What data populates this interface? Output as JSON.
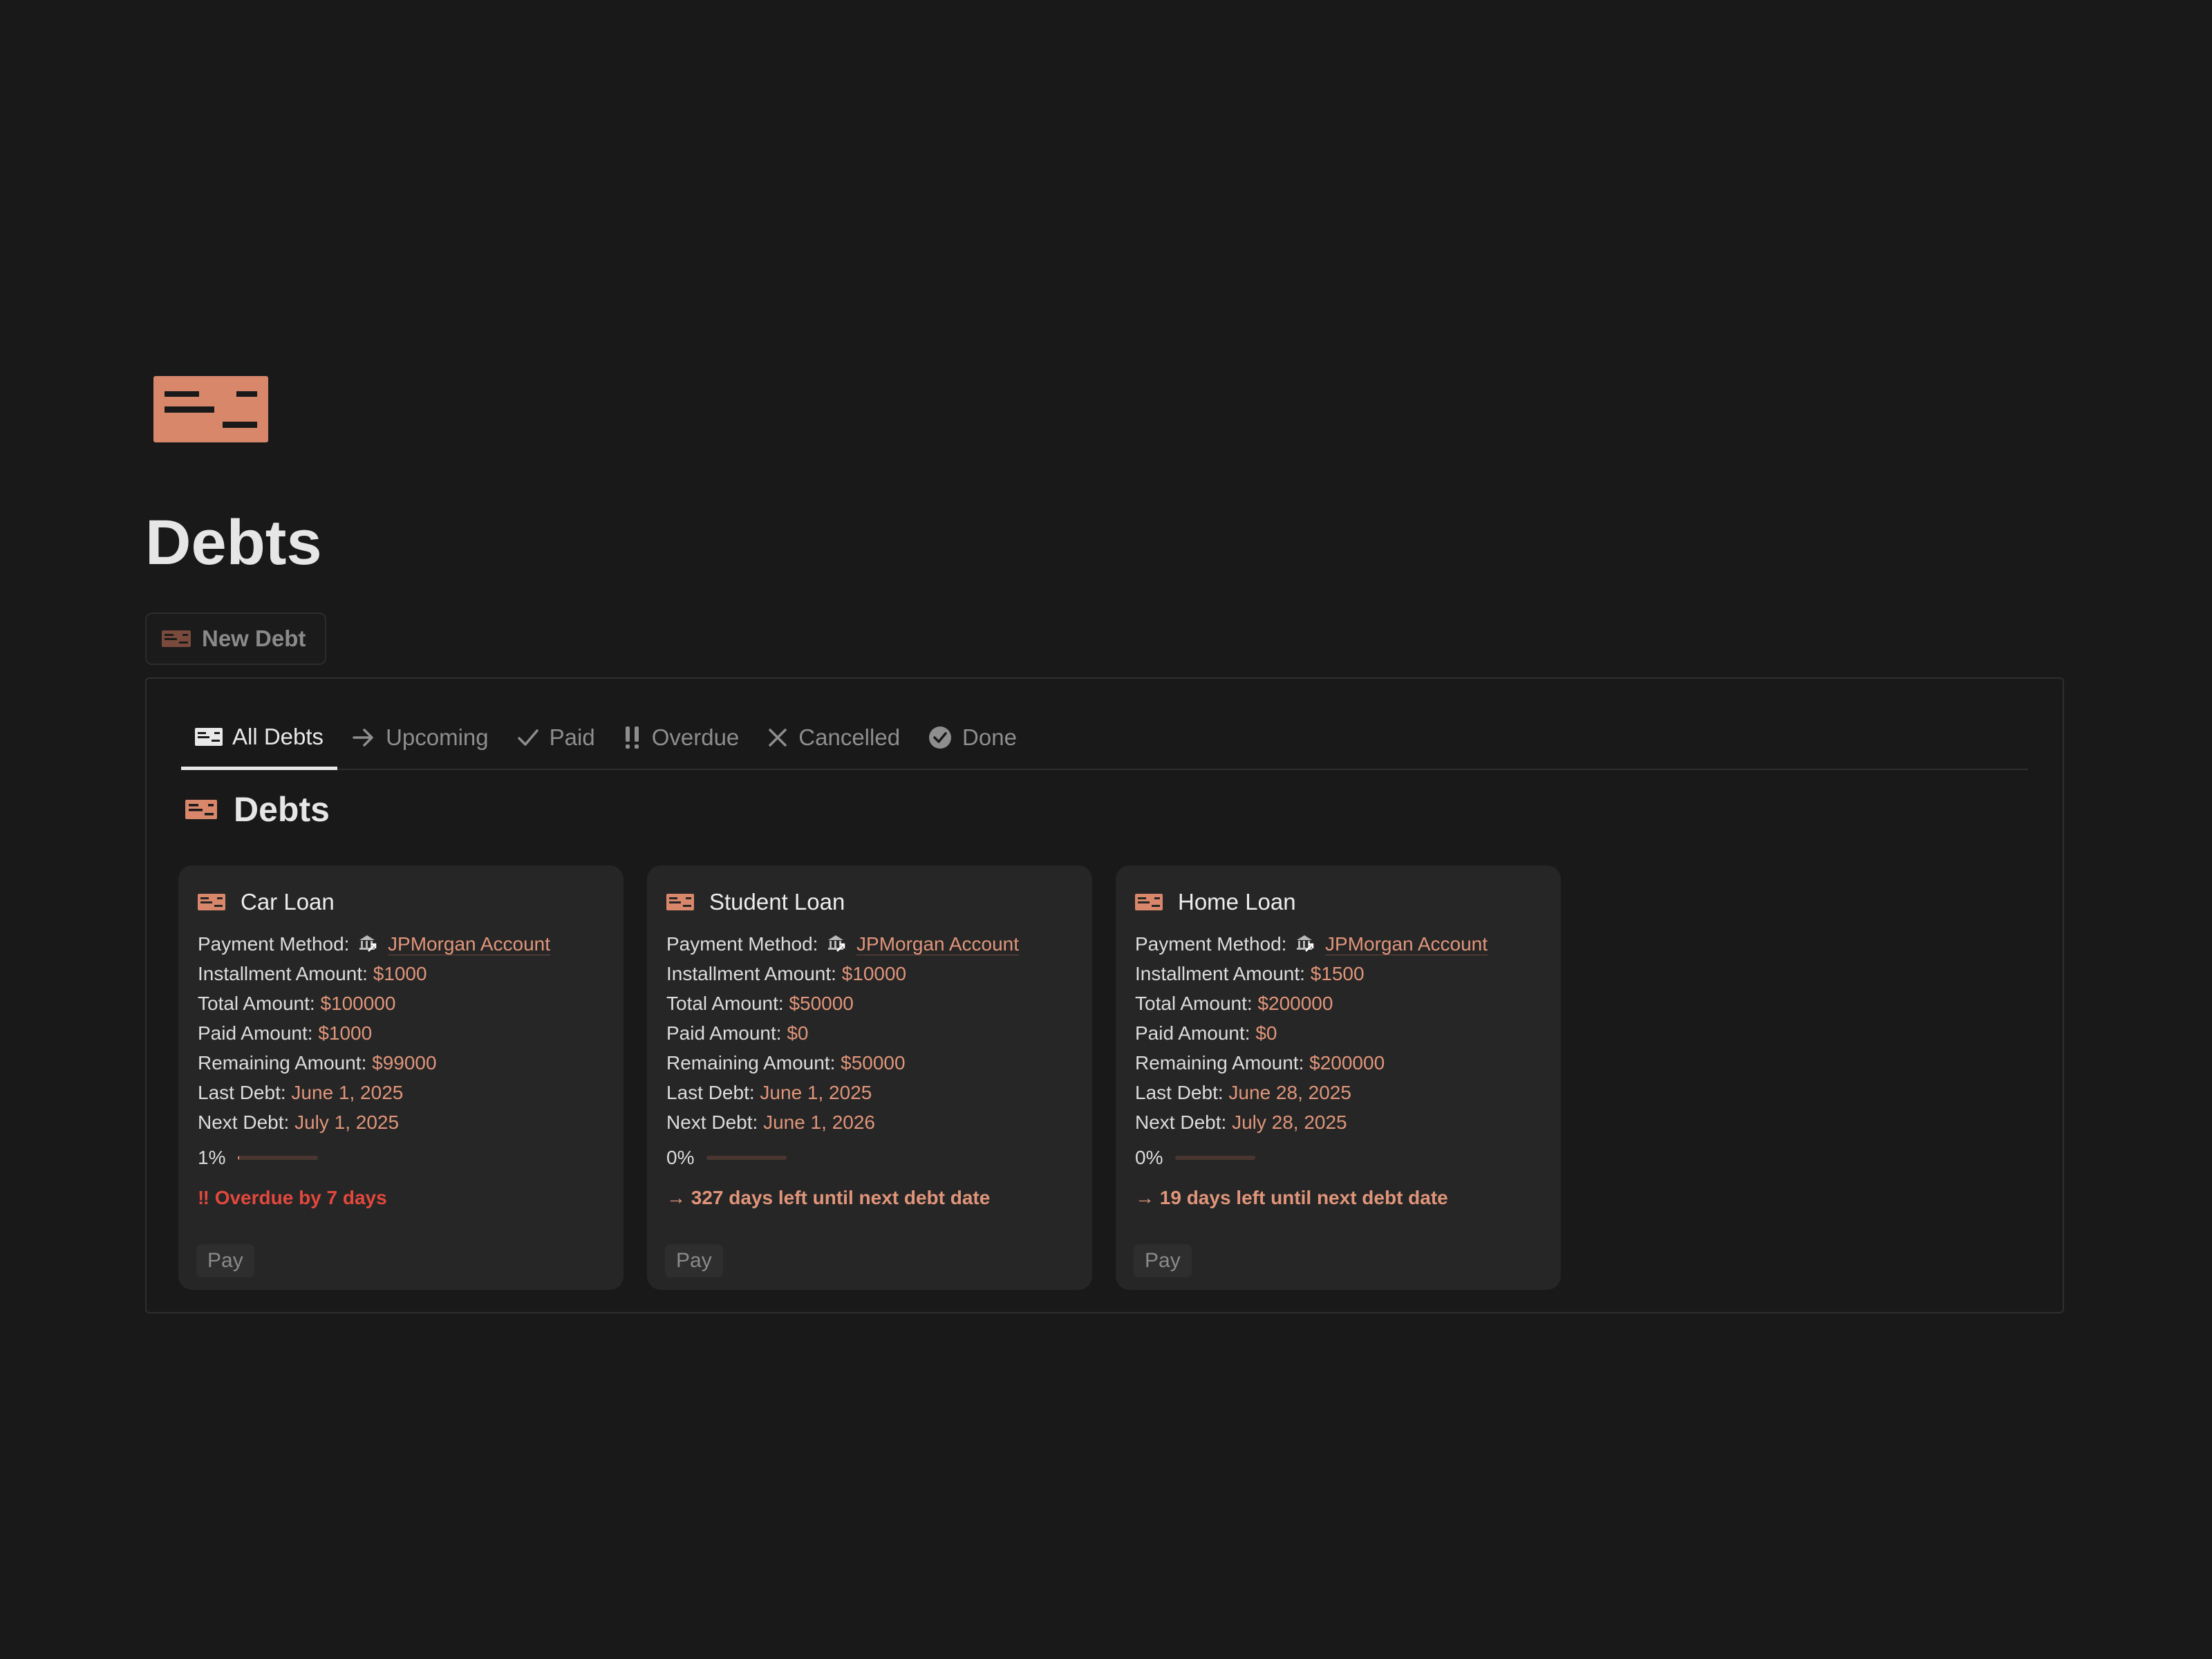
{
  "page": {
    "title": "Debts",
    "icon": "debt-card-icon",
    "accent": "#e0957a"
  },
  "new_button": {
    "label": "New Debt",
    "icon": "debt-card-icon"
  },
  "tabs": [
    {
      "label": "All Debts",
      "icon": "debt-card-icon",
      "active": true
    },
    {
      "label": "Upcoming",
      "icon": "arrow-right-icon",
      "active": false
    },
    {
      "label": "Paid",
      "icon": "check-icon",
      "active": false
    },
    {
      "label": "Overdue",
      "icon": "double-exclamation-icon",
      "active": false
    },
    {
      "label": "Cancelled",
      "icon": "x-icon",
      "active": false
    },
    {
      "label": "Done",
      "icon": "check-circle-icon",
      "active": false
    }
  ],
  "view": {
    "title": "Debts",
    "icon": "debt-card-icon"
  },
  "labels": {
    "payment_method": "Payment Method:",
    "installment": "Installment Amount:",
    "total": "Total Amount:",
    "paid": "Paid Amount:",
    "remaining": "Remaining Amount:",
    "last": "Last Debt:",
    "next": "Next Debt:"
  },
  "cards": [
    {
      "title": "Car Loan",
      "payment_method": "JPMorgan Account",
      "installment": "$1000",
      "total": "$100000",
      "paid": "$1000",
      "remaining": "$99000",
      "last": "June 1, 2025",
      "next": "July 1, 2025",
      "progress_label": "1%",
      "progress": 0.01,
      "status": "‼ Overdue by 7 days",
      "status_color": "#e2483d",
      "pay_label": "Pay"
    },
    {
      "title": "Student Loan",
      "payment_method": "JPMorgan Account",
      "installment": "$10000",
      "total": "$50000",
      "paid": "$0",
      "remaining": "$50000",
      "last": "June 1, 2025",
      "next": "June 1, 2026",
      "progress_label": "0%",
      "progress": 0,
      "status": "→ 327 days left until next debt date",
      "status_color": "#e0957a",
      "pay_label": "Pay"
    },
    {
      "title": "Home Loan",
      "payment_method": "JPMorgan Account",
      "installment": "$1500",
      "total": "$200000",
      "paid": "$0",
      "remaining": "$200000",
      "last": "June 28, 2025",
      "next": "July 28, 2025",
      "progress_label": "0%",
      "progress": 0,
      "status": "→ 19 days left until next debt date",
      "status_color": "#e0957a",
      "pay_label": "Pay"
    }
  ]
}
